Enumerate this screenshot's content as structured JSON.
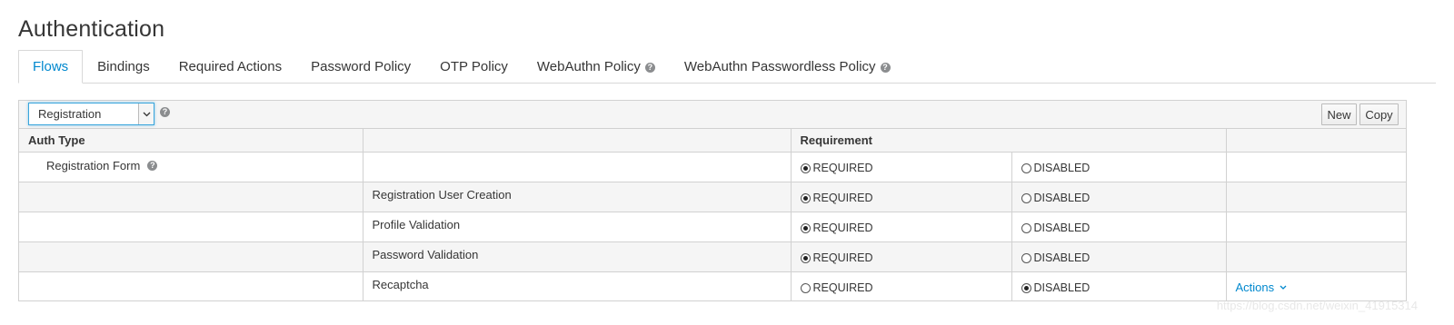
{
  "page": {
    "title": "Authentication"
  },
  "tabs": [
    {
      "label": "Flows",
      "active": true,
      "help": false
    },
    {
      "label": "Bindings",
      "active": false,
      "help": false
    },
    {
      "label": "Required Actions",
      "active": false,
      "help": false
    },
    {
      "label": "Password Policy",
      "active": false,
      "help": false
    },
    {
      "label": "OTP Policy",
      "active": false,
      "help": false
    },
    {
      "label": "WebAuthn Policy",
      "active": false,
      "help": true
    },
    {
      "label": "WebAuthn Passwordless Policy",
      "active": false,
      "help": true
    }
  ],
  "toolbar": {
    "flow_select": "Registration",
    "new_label": "New",
    "copy_label": "Copy"
  },
  "table": {
    "headers": {
      "auth_type": "Auth Type",
      "requirement": "Requirement"
    },
    "rows": [
      {
        "flow": "Registration Form",
        "execution": "",
        "required": "REQUIRED",
        "disabled": "DISABLED",
        "selected": "required",
        "actions": ""
      },
      {
        "flow": "",
        "execution": "Registration User Creation",
        "required": "REQUIRED",
        "disabled": "DISABLED",
        "selected": "required",
        "actions": ""
      },
      {
        "flow": "",
        "execution": "Profile Validation",
        "required": "REQUIRED",
        "disabled": "DISABLED",
        "selected": "required",
        "actions": ""
      },
      {
        "flow": "",
        "execution": "Password Validation",
        "required": "REQUIRED",
        "disabled": "DISABLED",
        "selected": "required",
        "actions": ""
      },
      {
        "flow": "",
        "execution": "Recaptcha",
        "required": "REQUIRED",
        "disabled": "DISABLED",
        "selected": "disabled",
        "actions": "Actions"
      }
    ]
  },
  "watermark": "https://blog.csdn.net/weixin_41915314",
  "colors": {
    "accent": "#0088ce",
    "header_bg": "#f5f5f5",
    "border": "#d1d1d1"
  }
}
